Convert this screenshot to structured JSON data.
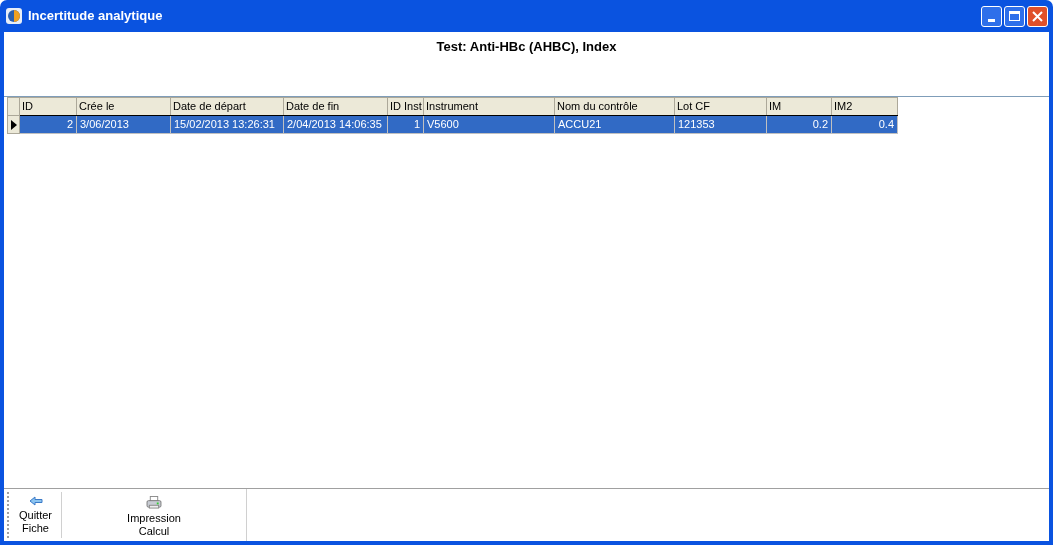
{
  "window": {
    "title": "Incertitude analytique"
  },
  "heading": "Test: Anti-HBc (AHBC), Index",
  "table": {
    "columns": [
      {
        "label": "ID",
        "kind": "number"
      },
      {
        "label": "Crée le",
        "kind": "text"
      },
      {
        "label": "Date de départ",
        "kind": "text"
      },
      {
        "label": "Date de fin",
        "kind": "text"
      },
      {
        "label": "ID Inst",
        "kind": "number"
      },
      {
        "label": "Instrument",
        "kind": "text"
      },
      {
        "label": "Nom du contrôle",
        "kind": "text"
      },
      {
        "label": "Lot CF",
        "kind": "text"
      },
      {
        "label": "IM",
        "kind": "number"
      },
      {
        "label": "IM2",
        "kind": "number"
      }
    ],
    "rows": [
      {
        "selected": true,
        "cells": [
          "2",
          "3/06/2013",
          "15/02/2013 13:26:31",
          "2/04/2013 14:06:35",
          "1",
          "V5600",
          "ACCU21",
          "121353",
          "0.2",
          "0.4"
        ]
      }
    ]
  },
  "toolbar": [
    {
      "kind": "back",
      "label": "Quitter Fiche"
    },
    {
      "kind": "print",
      "label": "Impression Calcul"
    }
  ]
}
